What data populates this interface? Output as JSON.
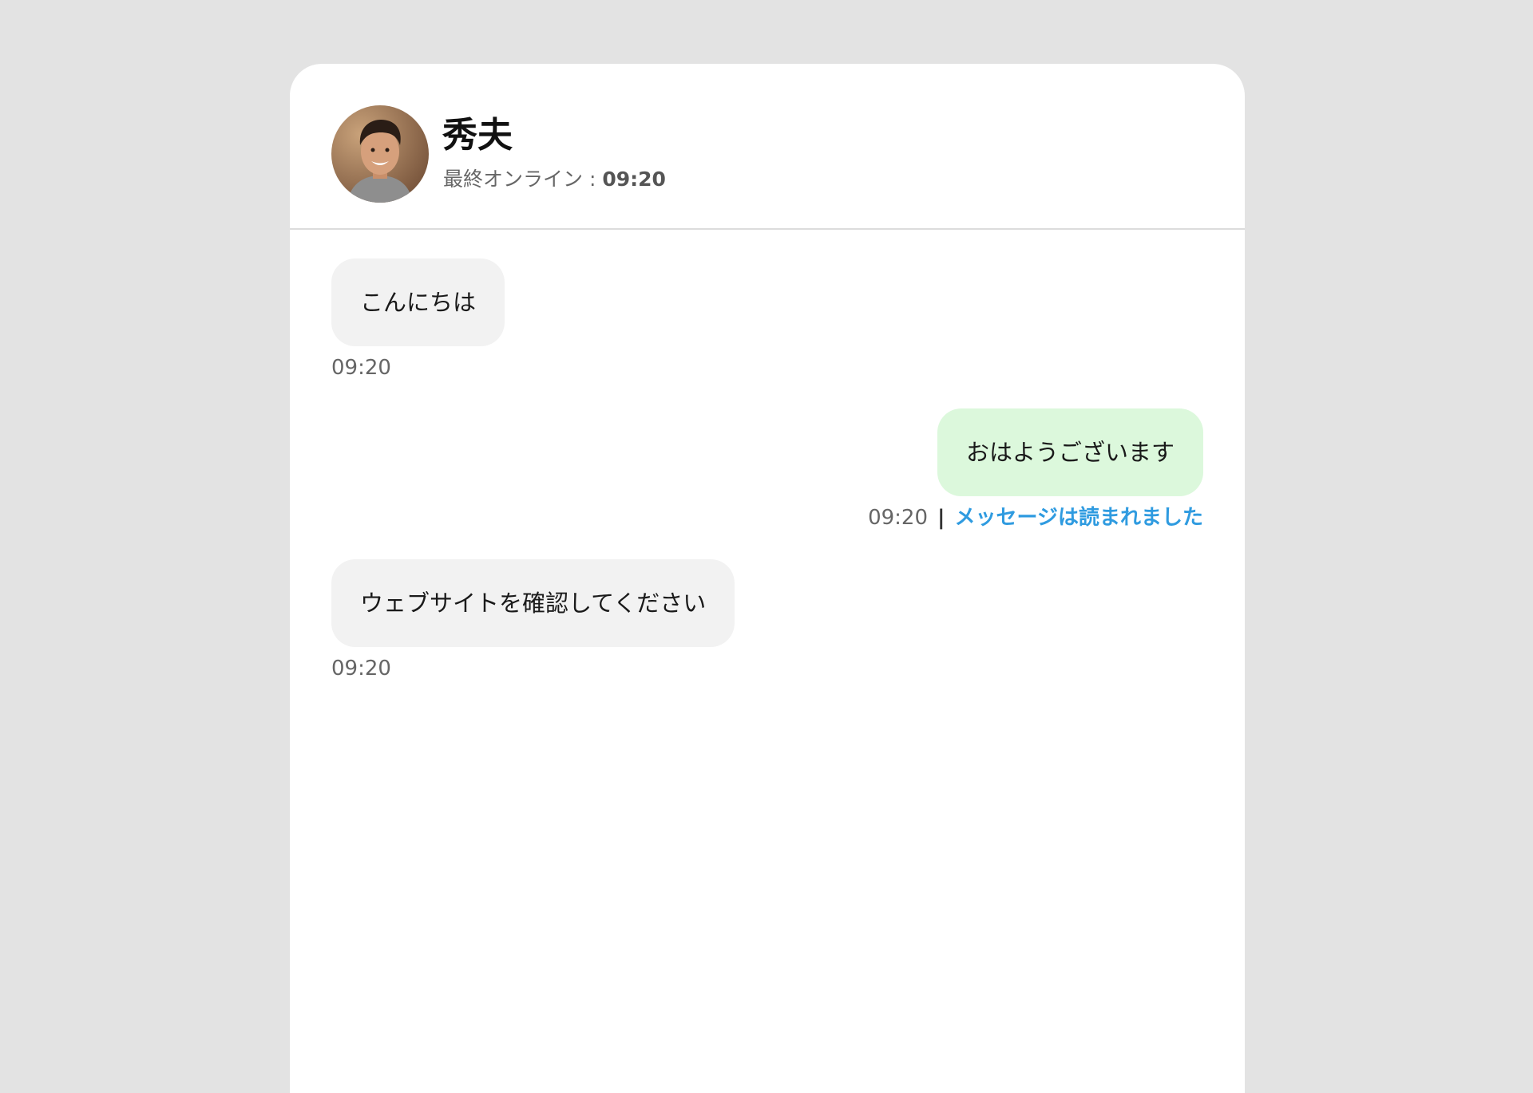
{
  "header": {
    "contact_name": "秀夫",
    "last_online_label": "最終オンライン : ",
    "last_online_time": "09:20"
  },
  "messages": [
    {
      "direction": "incoming",
      "text": "こんにちは",
      "time": "09:20"
    },
    {
      "direction": "outgoing",
      "text": "おはようございます",
      "time": "09:20",
      "separator": "|",
      "status": "メッセージは読まれました"
    },
    {
      "direction": "incoming",
      "text": "ウェブサイトを確認してください",
      "time": "09:20"
    }
  ],
  "colors": {
    "page_background": "#e3e3e3",
    "incoming_bubble": "#f2f2f2",
    "outgoing_bubble": "#dcf8dc",
    "read_status": "#2f9be0"
  }
}
